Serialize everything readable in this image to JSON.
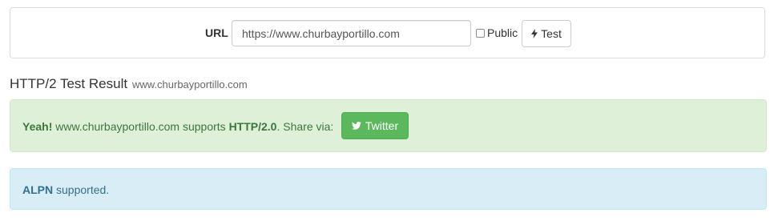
{
  "form": {
    "url_label": "URL",
    "url_value": "https://www.churbayportillo.com",
    "public_label": "Public",
    "public_checked": false,
    "test_label": "Test"
  },
  "result": {
    "title": "HTTP/2 Test Result",
    "domain": "www.churbayportillo.com"
  },
  "success_alert": {
    "yeah": "Yeah!",
    "host": " www.churbayportillo.com supports ",
    "protocol": "HTTP/2.0",
    "share_text": ". Share via:",
    "twitter_label": "Twitter",
    "color": "#5cb85c"
  },
  "info_alert": {
    "alpn": "ALPN",
    "supported": " supported."
  },
  "icons": {
    "test": "bolt-icon",
    "twitter": "twitter-icon"
  }
}
